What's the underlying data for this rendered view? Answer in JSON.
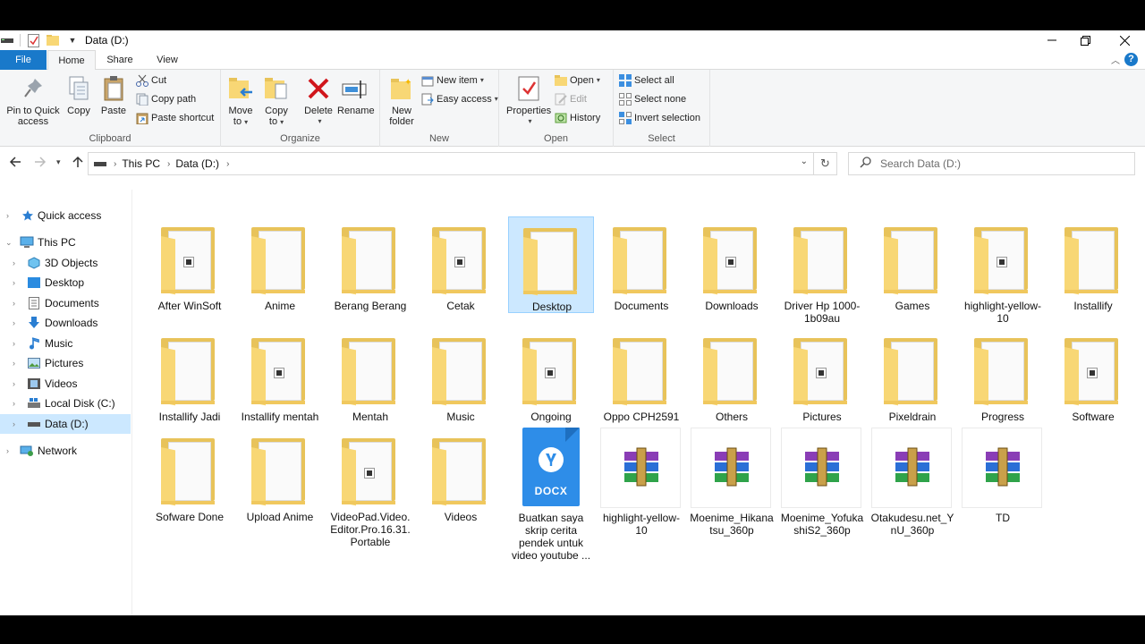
{
  "window": {
    "title": "Data (D:)",
    "controls": [
      "minimize",
      "maximize",
      "close"
    ]
  },
  "tabs": [
    {
      "label": "File"
    },
    {
      "label": "Home"
    },
    {
      "label": "Share"
    },
    {
      "label": "View"
    }
  ],
  "ribbon": {
    "clipboard": {
      "group_label": "Clipboard",
      "pin": "Pin to Quick access",
      "pin_line1": "Pin to Quick",
      "pin_line2": "access",
      "copy": "Copy",
      "paste": "Paste",
      "cut": "Cut",
      "copy_path": "Copy path",
      "paste_shortcut": "Paste shortcut"
    },
    "organize": {
      "group_label": "Organize",
      "move_to_1": "Move",
      "move_to_2": "to",
      "copy_to_1": "Copy",
      "copy_to_2": "to",
      "delete": "Delete",
      "rename": "Rename"
    },
    "new": {
      "group_label": "New",
      "new_folder_1": "New",
      "new_folder_2": "folder",
      "new_item": "New item",
      "easy_access": "Easy access"
    },
    "open": {
      "group_label": "Open",
      "properties": "Properties",
      "open": "Open",
      "edit": "Edit",
      "history": "History"
    },
    "select": {
      "group_label": "Select",
      "select_all": "Select all",
      "select_none": "Select none",
      "invert_selection": "Invert selection"
    }
  },
  "address": {
    "crumbs": [
      "This PC",
      "Data (D:)"
    ]
  },
  "search": {
    "placeholder": "Search Data (D:)"
  },
  "navpane": {
    "quick_access": "Quick access",
    "this_pc": "This PC",
    "children": [
      "3D Objects",
      "Desktop",
      "Documents",
      "Downloads",
      "Music",
      "Pictures",
      "Videos",
      "Local Disk (C:)",
      "Data (D:)"
    ],
    "network": "Network",
    "selected": "Data (D:)"
  },
  "items": [
    {
      "label": "After WinSoft",
      "kind": "folder"
    },
    {
      "label": "Anime",
      "kind": "folder"
    },
    {
      "label": "Berang Berang",
      "kind": "folder"
    },
    {
      "label": "Cetak",
      "kind": "folder"
    },
    {
      "label": "Desktop",
      "kind": "folder",
      "selected": true
    },
    {
      "label": "Documents",
      "kind": "folder"
    },
    {
      "label": "Downloads",
      "kind": "folder"
    },
    {
      "label": "Driver Hp 1000-1b09au",
      "kind": "folder"
    },
    {
      "label": "Games",
      "kind": "folder"
    },
    {
      "label": "highlight-yellow-10",
      "kind": "folder"
    },
    {
      "label": "Installify",
      "kind": "folder"
    },
    {
      "label": "Installify Jadi",
      "kind": "folder"
    },
    {
      "label": "Installify mentah",
      "kind": "folder"
    },
    {
      "label": "Mentah",
      "kind": "folder"
    },
    {
      "label": "Music",
      "kind": "folder"
    },
    {
      "label": "Ongoing",
      "kind": "folder"
    },
    {
      "label": "Oppo CPH2591",
      "kind": "folder"
    },
    {
      "label": "Others",
      "kind": "folder"
    },
    {
      "label": "Pictures",
      "kind": "folder"
    },
    {
      "label": "Pixeldrain",
      "kind": "folder"
    },
    {
      "label": "Progress",
      "kind": "folder"
    },
    {
      "label": "Software",
      "kind": "folder"
    },
    {
      "label": "Sofware Done",
      "kind": "folder"
    },
    {
      "label": "Upload Anime",
      "kind": "folder"
    },
    {
      "label": "VideoPad.Video.Editor.Pro.16.31.Portable",
      "kind": "folder"
    },
    {
      "label": "Videos",
      "kind": "folder"
    },
    {
      "label": "Buatkan saya skrip cerita pendek untuk video youtube ...",
      "kind": "docx",
      "badge": "DOCX"
    },
    {
      "label": "highlight-yellow-10",
      "kind": "rar"
    },
    {
      "label": "Moenime_Hikanatsu_360p",
      "kind": "rar"
    },
    {
      "label": "Moenime_YofukashiS2_360p",
      "kind": "rar"
    },
    {
      "label": "Otakudesu.net_YnU_360p",
      "kind": "rar"
    },
    {
      "label": "TD",
      "kind": "rar"
    }
  ],
  "colors": {
    "accent": "#1979ca",
    "selection": "#cce8ff",
    "folder": "#f8d775"
  }
}
